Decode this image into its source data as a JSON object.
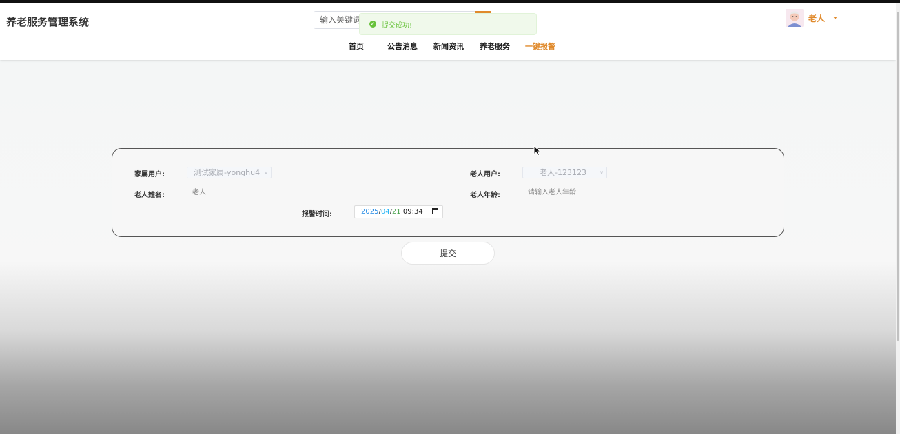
{
  "app": {
    "title": "养老服务管理系统"
  },
  "search": {
    "placeholder": "输入关键词"
  },
  "toast": {
    "message": "提交成功!",
    "icon": "check-circle-icon"
  },
  "nav": {
    "items": [
      {
        "label": "首页"
      },
      {
        "label": "公告消息"
      },
      {
        "label": "新闻资讯"
      },
      {
        "label": "养老服务"
      },
      {
        "label": "一键报警",
        "active": true
      }
    ]
  },
  "user": {
    "name": "老人",
    "avatar_icon": "elderly-avatar-icon"
  },
  "form": {
    "family_user_label": "家屬用户:",
    "family_user_value": "测试家属-yonghu4",
    "elder_user_label": "老人用户:",
    "elder_user_value": "老人-123123",
    "elder_name_label": "老人姓名:",
    "elder_name_placeholder": "老人",
    "elder_age_label": "老人年龄:",
    "elder_age_placeholder": "请输入老人年龄",
    "alarm_time_label": "报警时间:",
    "alarm_time": {
      "year": "2025",
      "month": "04",
      "day": "21",
      "time": "09:34"
    }
  },
  "submit": {
    "label": "提交"
  },
  "colors": {
    "accent": "#e08a2c",
    "success": "#67c23a"
  }
}
